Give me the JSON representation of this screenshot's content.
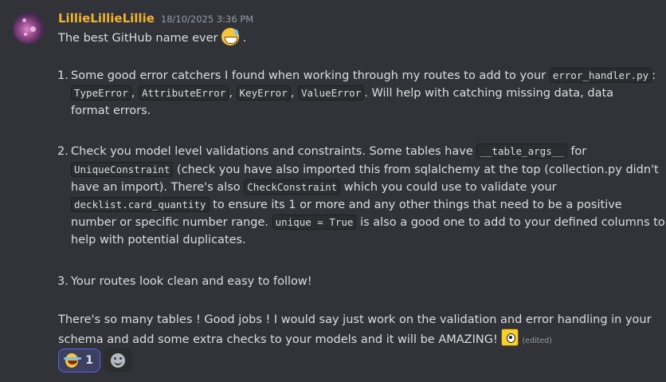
{
  "message": {
    "username": "LillieLillieLillie",
    "timestamp": "18/10/2025 3:36 PM",
    "intro": {
      "text": "The best GitHub name ever ",
      "trail": " .",
      "emoji": "grinning-sweat-emoji"
    },
    "item1": {
      "number": "1.",
      "t1": "Some good error catchers I found when working through my routes to add to your ",
      "c1": "error_handler.py",
      "t2": ":",
      "c2": "TypeError",
      "t3": ", ",
      "c3": "AttributeError",
      "t4": ", ",
      "c4": "KeyError",
      "t5": ", ",
      "c5": "ValueError",
      "t6": ". Will help with catching missing data, data",
      "t7": "format errors."
    },
    "item2": {
      "number": "2.",
      "t1": "Check you model level validations and constraints. Some tables have ",
      "c1": "__table_args__",
      "t2": " for",
      "c2": "UniqueConstraint",
      "t3": " (check you have also imported this from sqlalchemy at the top (collection.py didn't",
      "t4": "have an import). There's also ",
      "c3": "CheckConstraint",
      "t5": " which you could use to validate  your",
      "c4": "decklist.card_quantity",
      "t6": " to ensure its 1 or more and any other things that need to be a positive",
      "t7": "number or specific number range. ",
      "c5": "unique = True",
      "t8": " is also a good one to add to your defined columns to",
      "t9": "help with potential duplicates."
    },
    "item3": {
      "number": "3.",
      "text": "Your routes look clean and easy to follow!"
    },
    "closing": {
      "line1": "There's so many tables ! Good jobs  ! I would say just work on the validation and error handling in your",
      "line2": "schema and add some extra checks to your models and it will be AMAZING! ",
      "sticker": "eye-sticker-emoji",
      "edited": "(edited)"
    }
  },
  "reactions": [
    {
      "emoji": "joy-emoji",
      "count": "1",
      "active": true
    }
  ],
  "add_reaction": {
    "icon": "add-reaction-icon"
  },
  "colors": {
    "background": "#313338",
    "username": "#f0b232",
    "text": "#dbdee1",
    "muted": "#949ba4",
    "accent": "#5865f2"
  }
}
